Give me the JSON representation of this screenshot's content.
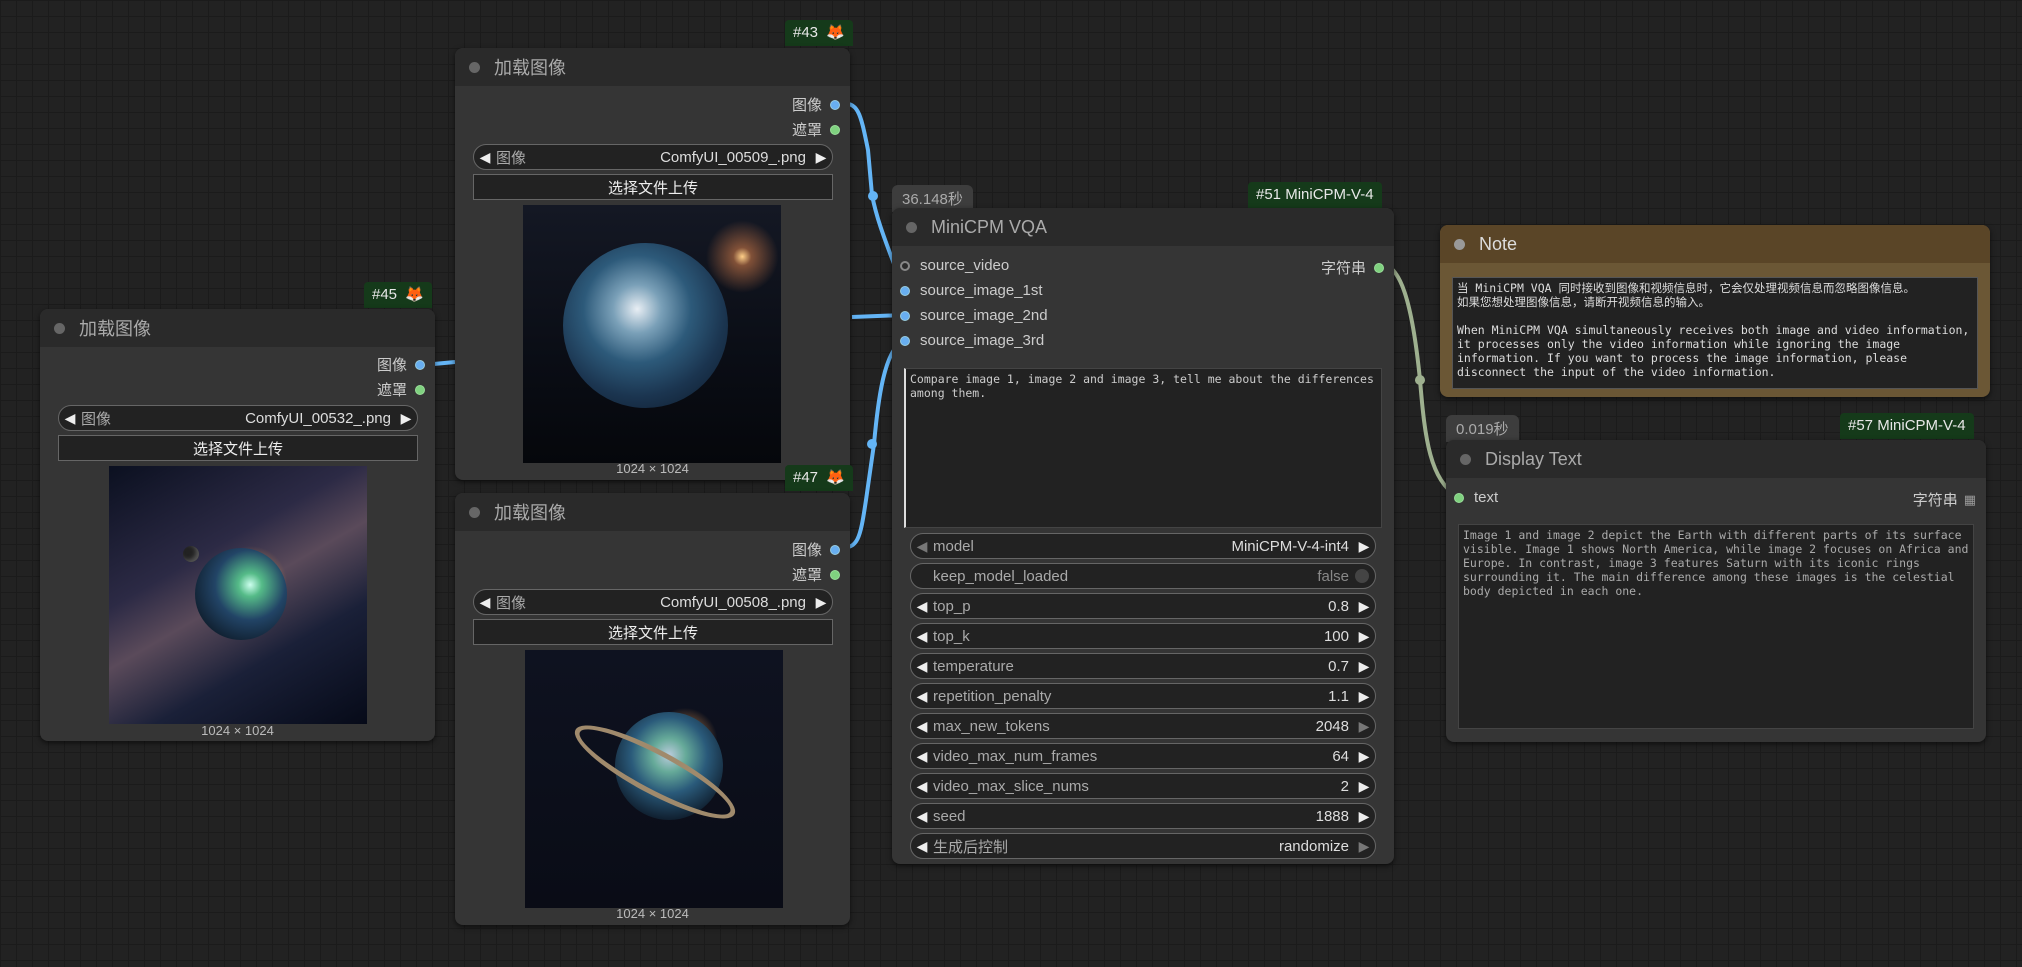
{
  "nodes": {
    "load45": {
      "id_badge": "#45",
      "title": "加载图像",
      "outputs": [
        "图像",
        "遮罩"
      ],
      "combo_label": "图像",
      "combo_value": "ComfyUI_00532_.png",
      "upload_label": "选择文件上传",
      "dims": "1024 × 1024"
    },
    "load43": {
      "id_badge": "#43",
      "title": "加载图像",
      "outputs": [
        "图像",
        "遮罩"
      ],
      "combo_label": "图像",
      "combo_value": "ComfyUI_00509_.png",
      "upload_label": "选择文件上传",
      "dims": "1024 × 1024"
    },
    "load47": {
      "id_badge": "#47",
      "title": "加载图像",
      "outputs": [
        "图像",
        "遮罩"
      ],
      "combo_label": "图像",
      "combo_value": "ComfyUI_00508_.png",
      "upload_label": "选择文件上传",
      "dims": "1024 × 1024"
    },
    "vqa": {
      "exec_time": "36.148秒",
      "id_badge": "#51 MiniCPM-V-4",
      "title": "MiniCPM VQA",
      "inputs": [
        "source_video",
        "source_image_1st",
        "source_image_2nd",
        "source_image_3rd"
      ],
      "output": "字符串",
      "prompt": "Compare image 1, image 2 and image 3, tell me about the differences among them.",
      "widgets": [
        {
          "label": "model",
          "value": "MiniCPM-V-4-int4"
        },
        {
          "label": "keep_model_loaded",
          "value": "false"
        },
        {
          "label": "top_p",
          "value": "0.8"
        },
        {
          "label": "top_k",
          "value": "100"
        },
        {
          "label": "temperature",
          "value": "0.7"
        },
        {
          "label": "repetition_penalty",
          "value": "1.1"
        },
        {
          "label": "max_new_tokens",
          "value": "2048"
        },
        {
          "label": "video_max_num_frames",
          "value": "64"
        },
        {
          "label": "video_max_slice_nums",
          "value": "2"
        },
        {
          "label": "seed",
          "value": "1888"
        },
        {
          "label": "生成后控制",
          "value": "randomize"
        }
      ]
    },
    "note": {
      "title": "Note",
      "text": "当 MiniCPM VQA 同时接收到图像和视频信息时，它会仅处理视频信息而忽略图像信息。\n如果您想处理图像信息，请断开视频信息的输入。\n\nWhen MiniCPM VQA simultaneously receives both image and video information, it processes only the video information while ignoring the image information. If you want to process the image information, please disconnect the input of the video information."
    },
    "display": {
      "exec_time": "0.019秒",
      "id_badge": "#57 MiniCPM-V-4",
      "title": "Display Text",
      "input": "text",
      "output": "字符串",
      "text": "Image 1 and image 2 depict the Earth with different parts of its surface visible. Image 1 shows North America, while image 2 focuses on Africa and Europe. In contrast, image 3 features Saturn with its iconic rings surrounding it. The main difference among these images is the celestial body depicted in each one."
    }
  },
  "colors": {
    "canvas": "#222222",
    "node_bg": "#353535",
    "title_bg": "#2a2a2a",
    "image_link": "#64b5f6",
    "string_link": "#9eb08f",
    "badge_bg": "#153a1a",
    "note_bg": "#6b5735",
    "note_title": "#5a4527"
  },
  "icons": [
    "fox-icon",
    "grid-icon",
    "toggle-icon",
    "arrow-left-icon",
    "arrow-right-icon"
  ]
}
